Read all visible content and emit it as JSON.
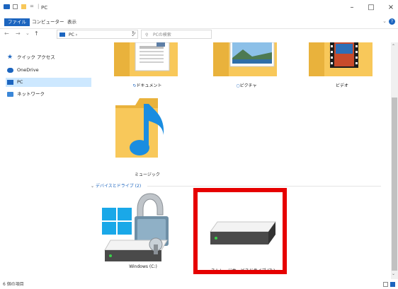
{
  "window": {
    "title": "PC"
  },
  "ribbon": {
    "tabs": [
      "ファイル",
      "コンピューター",
      "表示"
    ]
  },
  "address": {
    "path": "PC"
  },
  "search": {
    "placeholder": "PCの検索"
  },
  "nav": {
    "items": [
      {
        "label": "クイック アクセス",
        "icon": "star-icon"
      },
      {
        "label": "OneDrive",
        "icon": "cloud-icon"
      },
      {
        "label": "PC",
        "icon": "computer-icon",
        "selected": true
      },
      {
        "label": "ネットワーク",
        "icon": "network-icon"
      }
    ]
  },
  "folders": [
    {
      "label": "ドキュメント"
    },
    {
      "label": "ピクチャ"
    },
    {
      "label": "ビデオ"
    },
    {
      "label": "ミュージック"
    }
  ],
  "devices": {
    "header": "デバイスとドライブ (2)",
    "items": [
      {
        "label": "Windows (C:)"
      },
      {
        "label": "ストレージサービスドライブ (Z:)",
        "highlighted": true
      }
    ]
  },
  "status": {
    "count": "6 個の項目"
  },
  "colors": {
    "accent": "#1c65bf",
    "highlight": "#e60000",
    "folder": "#f8c85a"
  }
}
